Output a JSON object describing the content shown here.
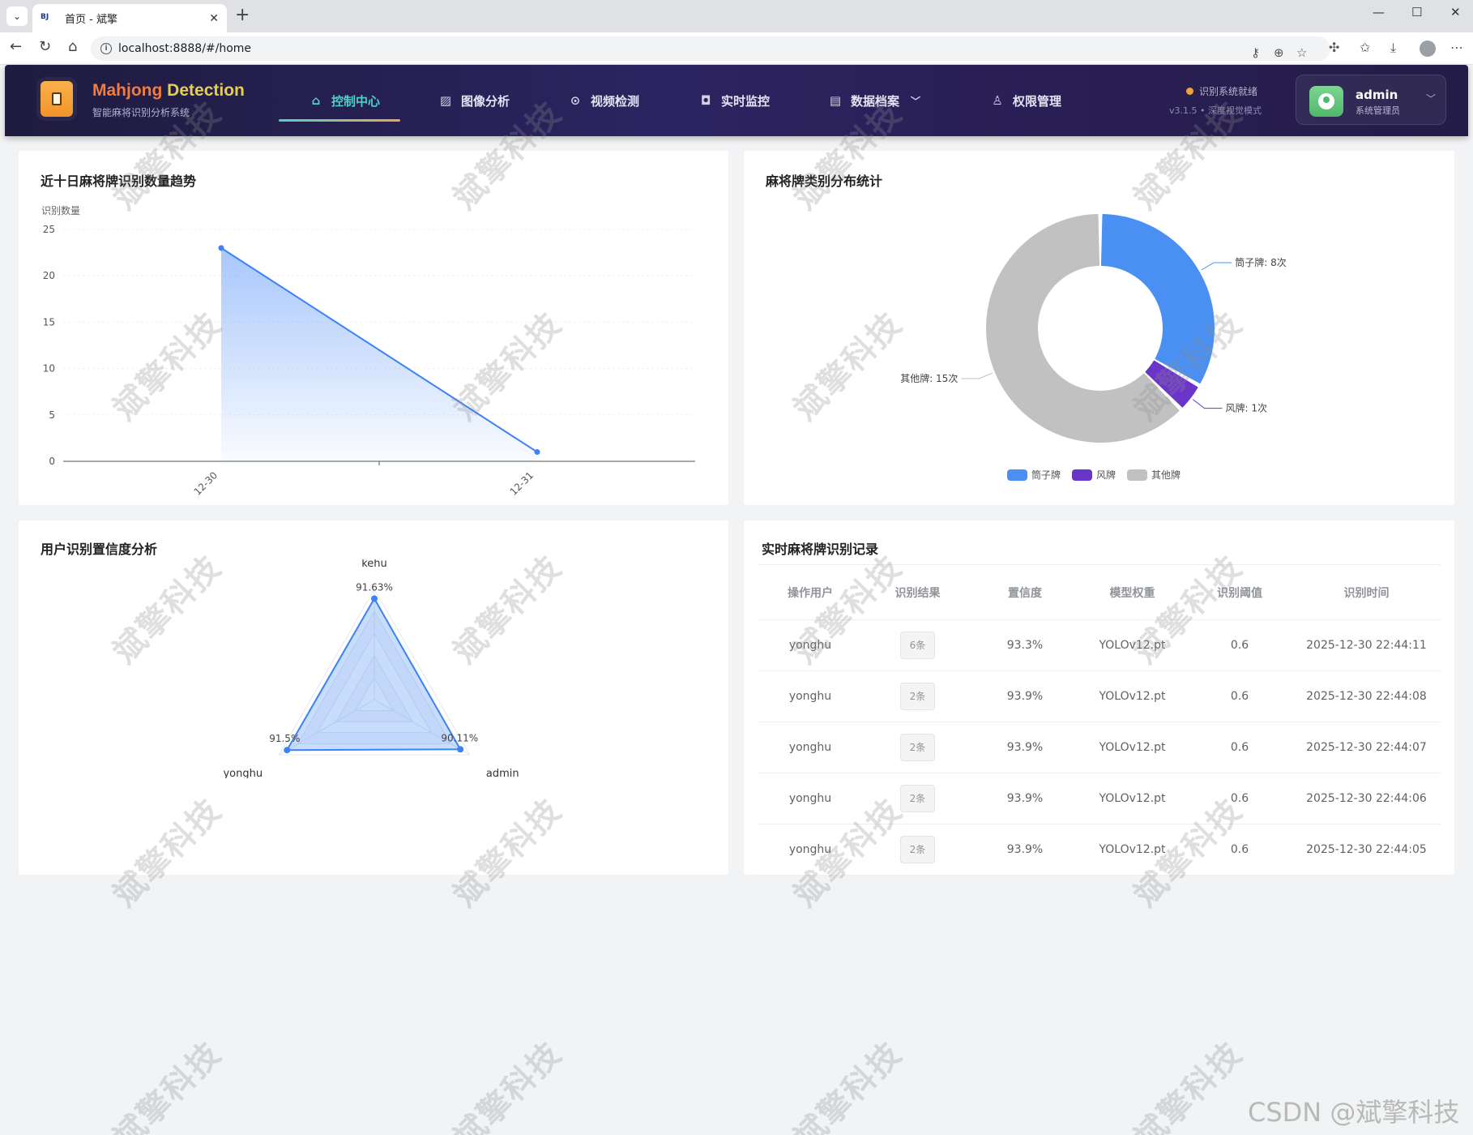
{
  "browser": {
    "tab_title": "首页 - 斌擎",
    "favicon_text": "BJ",
    "url": "localhost:8888/#/home"
  },
  "header": {
    "brand_part1": "Mahjong",
    "brand_part2": "Detection",
    "subtitle": "智能麻将识别分析系统",
    "nav": [
      {
        "label": "控制中心",
        "icon": "home-icon",
        "active": true
      },
      {
        "label": "图像分析",
        "icon": "image-icon",
        "active": false
      },
      {
        "label": "视频检测",
        "icon": "play-circle-icon",
        "active": false
      },
      {
        "label": "实时监控",
        "icon": "camera-icon",
        "active": false
      },
      {
        "label": "数据档案",
        "icon": "document-icon",
        "active": false
      },
      {
        "label": "权限管理",
        "icon": "user-icon",
        "active": false
      }
    ],
    "status": "识别系统就绪",
    "version": "v3.1.5 • 深度视觉模式",
    "user_name": "admin",
    "user_role": "系统管理员",
    "colors": {
      "accent": "#4fd1c5",
      "status_dot": "#f0a23a"
    }
  },
  "cards": {
    "trend_title": "近十日麻将牌识别数量趋势",
    "category_title": "麻将牌类别分布统计",
    "radar_title": "用户识别置信度分析",
    "records_title": "实时麻将牌识别记录"
  },
  "chart_data": [
    {
      "type": "area",
      "title": "近十日麻将牌识别数量趋势",
      "ylabel": "识别数量",
      "categories": [
        "12-30",
        "12-31"
      ],
      "values": [
        23,
        1
      ],
      "ylim": [
        0,
        25
      ],
      "yticks": [
        0,
        5,
        10,
        15,
        20,
        25
      ],
      "grid": true,
      "color": "#3b82f6"
    },
    {
      "type": "pie",
      "title": "麻将牌类别分布统计",
      "donut": true,
      "slices": [
        {
          "label": "筒子牌",
          "value": 8,
          "color": "#4a90f2",
          "data_label": "筒子牌: 8次"
        },
        {
          "label": "风牌",
          "value": 1,
          "color": "#6b35c9",
          "data_label": "风牌: 1次"
        },
        {
          "label": "其他牌",
          "value": 15,
          "color": "#c1c1c1",
          "data_label": "其他牌: 15次"
        }
      ],
      "legend_position": "bottom"
    },
    {
      "type": "radar",
      "title": "用户识别置信度分析",
      "axes": [
        "kehu",
        "admin",
        "yonghu"
      ],
      "values": [
        91.63,
        90.11,
        91.5
      ],
      "value_labels": [
        "91.63%",
        "90.11%",
        "91.5%"
      ],
      "color": "#3b82f6"
    }
  ],
  "records": {
    "columns": [
      "操作用户",
      "识别结果",
      "置信度",
      "模型权重",
      "识别阈值",
      "识别时间"
    ],
    "rows": [
      {
        "user": "yonghu",
        "result": "6条",
        "confidence": "93.3%",
        "model": "YOLOv12.pt",
        "threshold": "0.6",
        "time": "2025-12-30 22:44:11"
      },
      {
        "user": "yonghu",
        "result": "2条",
        "confidence": "93.9%",
        "model": "YOLOv12.pt",
        "threshold": "0.6",
        "time": "2025-12-30 22:44:08"
      },
      {
        "user": "yonghu",
        "result": "2条",
        "confidence": "93.9%",
        "model": "YOLOv12.pt",
        "threshold": "0.6",
        "time": "2025-12-30 22:44:07"
      },
      {
        "user": "yonghu",
        "result": "2条",
        "confidence": "93.9%",
        "model": "YOLOv12.pt",
        "threshold": "0.6",
        "time": "2025-12-30 22:44:06"
      },
      {
        "user": "yonghu",
        "result": "2条",
        "confidence": "93.9%",
        "model": "YOLOv12.pt",
        "threshold": "0.6",
        "time": "2025-12-30 22:44:05"
      }
    ]
  },
  "watermark_text": "斌擎科技",
  "csdn_mark": "CSDN @斌擎科技"
}
